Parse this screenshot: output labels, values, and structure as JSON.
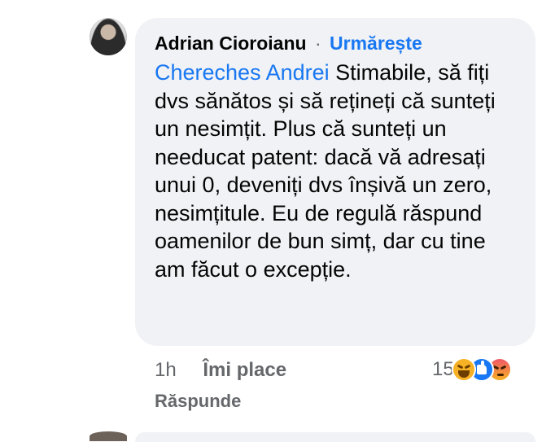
{
  "comment": {
    "author": "Adrian Cioroianu",
    "separator": "·",
    "follow_label": "Urmărește",
    "mention": "Chereches Andrei",
    "text": " Stimabile, să fiți dvs sănătos și să rețineți că sunteți un nesimțit. Plus că sunteți un needucat patent: dacă vă adresați unui 0, deveniți dvs înșivă un zero, nesimțitule. Eu de regulă răspund oamenilor de bun simț, dar cu tine am făcut o excepție."
  },
  "meta": {
    "time": "1h",
    "like_label": "Îmi place",
    "reply_label": "Răspunde",
    "reaction_count": "15",
    "reaction_icons": [
      "haha-icon",
      "like-icon",
      "angry-icon"
    ]
  },
  "colors": {
    "bubble": "#f0f2f5",
    "link": "#1877f2",
    "secondary_text": "#65676b"
  }
}
